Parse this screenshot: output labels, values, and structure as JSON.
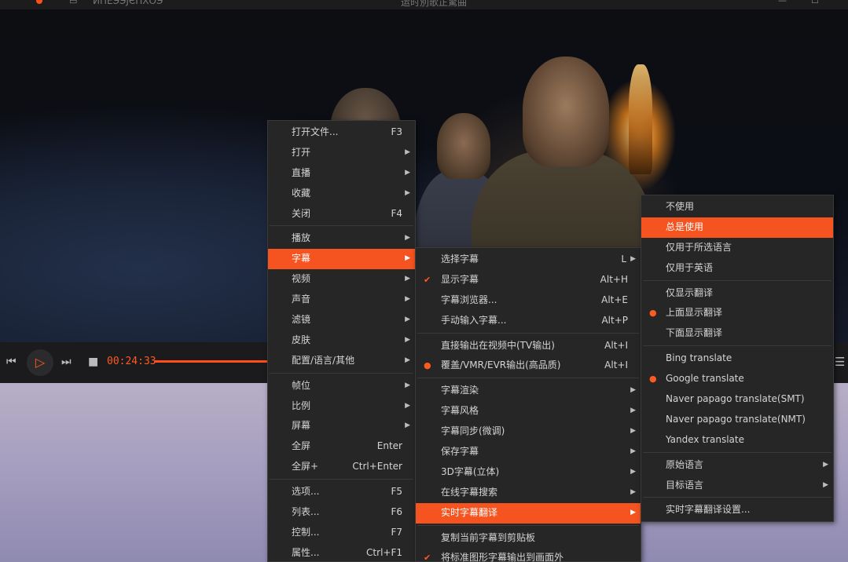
{
  "titlebar": {
    "app_name": "ИПЕЭЭЈЄПХОЭ",
    "window_title": "运时別歌正驚曲"
  },
  "player": {
    "time": "00:24:33",
    "progress_fraction": 0.054,
    "accent_color": "#ff5a1f"
  },
  "menu_main": {
    "items": [
      {
        "label": "打开文件...",
        "shortcut": "F3",
        "submenu": false
      },
      {
        "label": "打开",
        "shortcut": "",
        "submenu": true
      },
      {
        "label": "直播",
        "shortcut": "",
        "submenu": true
      },
      {
        "label": "收藏",
        "shortcut": "",
        "submenu": true
      },
      {
        "label": "关闭",
        "shortcut": "F4",
        "submenu": false
      },
      {
        "label": "播放",
        "shortcut": "",
        "submenu": true
      },
      {
        "label": "字幕",
        "shortcut": "",
        "submenu": true
      },
      {
        "label": "视频",
        "shortcut": "",
        "submenu": true
      },
      {
        "label": "声音",
        "shortcut": "",
        "submenu": true
      },
      {
        "label": "滤镜",
        "shortcut": "",
        "submenu": true
      },
      {
        "label": "皮肤",
        "shortcut": "",
        "submenu": true
      },
      {
        "label": "配置/语言/其他",
        "shortcut": "",
        "submenu": true
      },
      {
        "label": "帧位",
        "shortcut": "",
        "submenu": true
      },
      {
        "label": "比例",
        "shortcut": "",
        "submenu": true
      },
      {
        "label": "屏幕",
        "shortcut": "",
        "submenu": true
      },
      {
        "label": "全屏",
        "shortcut": "Enter",
        "submenu": false
      },
      {
        "label": "全屏+",
        "shortcut": "Ctrl+Enter",
        "submenu": false
      },
      {
        "label": "选项...",
        "shortcut": "F5",
        "submenu": false
      },
      {
        "label": "列表...",
        "shortcut": "F6",
        "submenu": false
      },
      {
        "label": "控制...",
        "shortcut": "F7",
        "submenu": false
      },
      {
        "label": "属性...",
        "shortcut": "Ctrl+F1",
        "submenu": false
      }
    ]
  },
  "menu_subtitle": {
    "items": [
      {
        "label": "选择字幕",
        "shortcut": "L",
        "submenu": true,
        "mark": ""
      },
      {
        "label": "显示字幕",
        "shortcut": "Alt+H",
        "submenu": false,
        "mark": "✔"
      },
      {
        "label": "字幕浏览器...",
        "shortcut": "Alt+E",
        "submenu": false,
        "mark": ""
      },
      {
        "label": "手动输入字幕...",
        "shortcut": "Alt+P",
        "submenu": false,
        "mark": ""
      },
      {
        "label": "直接输出在视频中(TV输出)",
        "shortcut": "Alt+I",
        "submenu": false,
        "mark": ""
      },
      {
        "label": "覆盖/VMR/EVR输出(高品质)",
        "shortcut": "Alt+I",
        "submenu": false,
        "mark": "●"
      },
      {
        "label": "字幕渲染",
        "shortcut": "",
        "submenu": true,
        "mark": ""
      },
      {
        "label": "字幕风格",
        "shortcut": "",
        "submenu": true,
        "mark": ""
      },
      {
        "label": "字幕同步(微调)",
        "shortcut": "",
        "submenu": true,
        "mark": ""
      },
      {
        "label": "保存字幕",
        "shortcut": "",
        "submenu": true,
        "mark": ""
      },
      {
        "label": "3D字幕(立体)",
        "shortcut": "",
        "submenu": true,
        "mark": ""
      },
      {
        "label": "在线字幕搜索",
        "shortcut": "",
        "submenu": true,
        "mark": ""
      },
      {
        "label": "实时字幕翻译",
        "shortcut": "",
        "submenu": true,
        "mark": ""
      },
      {
        "label": "复制当前字幕到剪贴板",
        "shortcut": "",
        "submenu": false,
        "mark": ""
      },
      {
        "label": "将标准图形字幕输出到画面外",
        "shortcut": "",
        "submenu": false,
        "mark": "✔"
      }
    ]
  },
  "menu_translate": {
    "items": [
      {
        "label": "不使用",
        "submenu": false,
        "mark": ""
      },
      {
        "label": "总是使用",
        "submenu": false,
        "mark": ""
      },
      {
        "label": "仅用于所选语言",
        "submenu": false,
        "mark": ""
      },
      {
        "label": "仅用于英语",
        "submenu": false,
        "mark": ""
      },
      {
        "label": "仅显示翻译",
        "submenu": false,
        "mark": ""
      },
      {
        "label": "上面显示翻译",
        "submenu": false,
        "mark": "●"
      },
      {
        "label": "下面显示翻译",
        "submenu": false,
        "mark": ""
      },
      {
        "label": "Bing translate",
        "submenu": false,
        "mark": ""
      },
      {
        "label": "Google translate",
        "submenu": false,
        "mark": "●"
      },
      {
        "label": "Naver papago translate(SMT)",
        "submenu": false,
        "mark": ""
      },
      {
        "label": "Naver papago translate(NMT)",
        "submenu": false,
        "mark": ""
      },
      {
        "label": "Yandex translate",
        "submenu": false,
        "mark": ""
      },
      {
        "label": "原始语言",
        "submenu": true,
        "mark": ""
      },
      {
        "label": "目标语言",
        "submenu": true,
        "mark": ""
      },
      {
        "label": "实时字幕翻译设置...",
        "submenu": false,
        "mark": ""
      }
    ]
  }
}
